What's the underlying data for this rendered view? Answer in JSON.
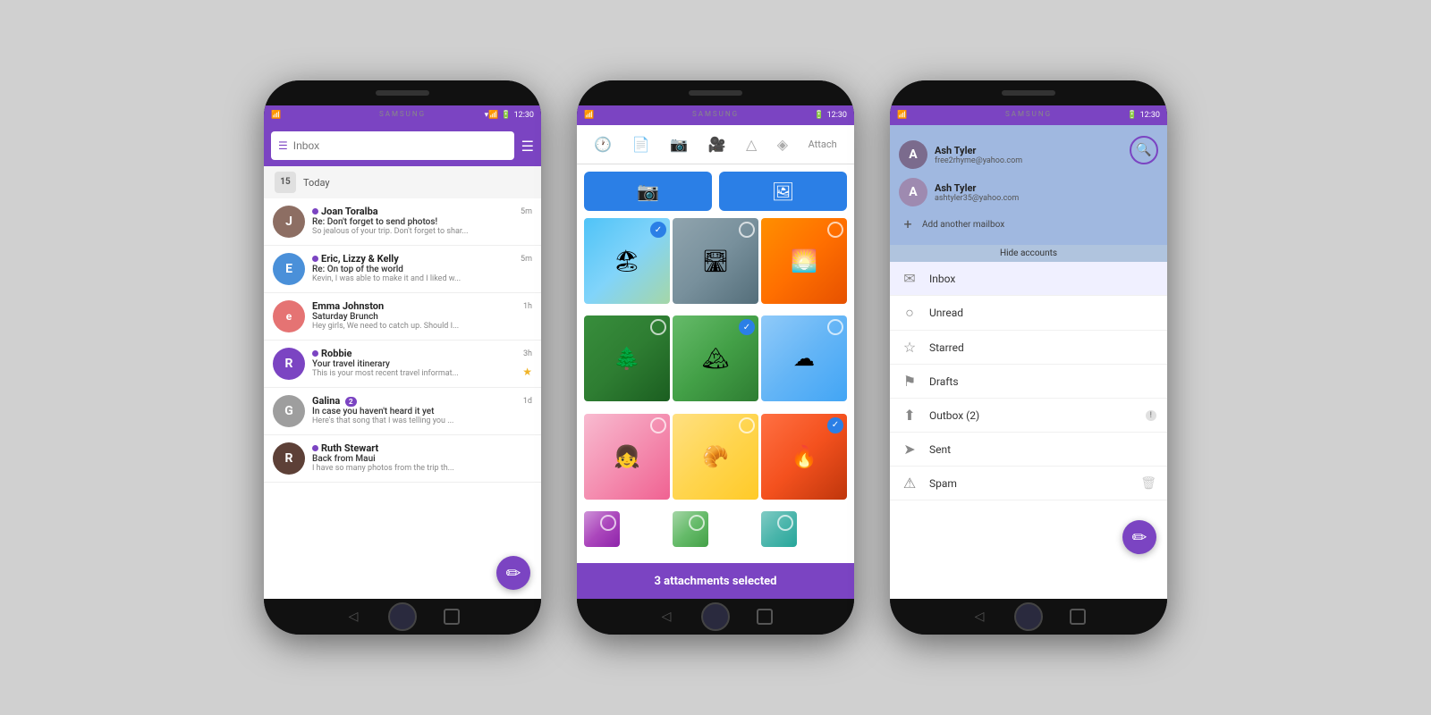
{
  "phones": {
    "phone1": {
      "statusBar": {
        "time": "12:30",
        "brand": "SAMSUNG"
      },
      "toolbar": {
        "searchPlaceholder": "Inbox",
        "listIconLabel": "≡"
      },
      "dateHeader": {
        "day": "15",
        "label": "Today"
      },
      "emails": [
        {
          "sender": "Joan Toralba",
          "subject": "Re: Don't forget to send photos!",
          "preview": "So jealous of your trip. Don't forget to shar...",
          "time": "5m",
          "unread": true,
          "avatarColor": "#8d6e63",
          "avatarInitial": "J"
        },
        {
          "sender": "Eric, Lizzy & Kelly",
          "subject": "Re: On top of the world",
          "preview": "Kevin, I was able to make it and I liked w...",
          "time": "5m",
          "unread": true,
          "avatarColor": "#4a90d9",
          "avatarInitial": "E"
        },
        {
          "sender": "Emma Johnston",
          "subject": "Saturday Brunch",
          "preview": "Hey girls, We need to catch up. Should I...",
          "time": "1h",
          "unread": false,
          "avatarColor": "#e57373",
          "avatarInitial": "e"
        },
        {
          "sender": "Robbie",
          "subject": "Your travel itinerary",
          "preview": "This is your most recent travel informat...",
          "time": "3h",
          "unread": true,
          "avatarColor": "#7b44c2",
          "avatarInitial": "R",
          "starred": true
        },
        {
          "sender": "Galina",
          "subject": "In case you haven't heard it yet",
          "preview": "Here's that song that I was telling you ...",
          "time": "1d",
          "unread": false,
          "avatarColor": "#9e9e9e",
          "avatarInitial": "G",
          "badge": 2
        },
        {
          "sender": "Ruth Stewart",
          "subject": "Back from Maui",
          "preview": "I have so many photos from the trip th...",
          "time": "",
          "unread": true,
          "avatarColor": "#5d4037",
          "avatarInitial": "R"
        }
      ]
    },
    "phone2": {
      "statusBar": {
        "time": "12:30",
        "brand": "SAMSUNG"
      },
      "attachLabel": "Attach",
      "attachmentsSelectedText": "3 attachments selected",
      "photos": [
        {
          "type": "beach",
          "selected": true
        },
        {
          "type": "road",
          "selected": false
        },
        {
          "type": "sunset",
          "selected": false
        },
        {
          "type": "forest",
          "selected": false
        },
        {
          "type": "green",
          "selected": true
        },
        {
          "type": "sky",
          "selected": false
        },
        {
          "type": "girl",
          "selected": false
        },
        {
          "type": "food",
          "selected": false
        },
        {
          "type": "fire",
          "selected": true
        },
        {
          "type": "partial1",
          "selected": false
        },
        {
          "type": "partial2",
          "selected": false
        },
        {
          "type": "partial3",
          "selected": false
        }
      ]
    },
    "phone3": {
      "statusBar": {
        "time": "12:30",
        "brand": "SAMSUNG"
      },
      "accounts": [
        {
          "name": "Ash Tyler",
          "email": "free2rhyme@yahoo.com"
        },
        {
          "name": "Ash Tyler",
          "email": "ashtyler35@yahoo.com"
        }
      ],
      "addAccountLabel": "Add another mailbox",
      "hideAccountsLabel": "Hide accounts",
      "navItems": [
        {
          "icon": "✉",
          "label": "Inbox",
          "active": true
        },
        {
          "icon": "○",
          "label": "Unread",
          "active": false
        },
        {
          "icon": "☆",
          "label": "Starred",
          "active": false
        },
        {
          "icon": "⚑",
          "label": "Drafts",
          "active": false
        },
        {
          "icon": "⬆",
          "label": "Outbox (2)",
          "active": false,
          "badge": "!"
        },
        {
          "icon": "➤",
          "label": "Sent",
          "active": false
        },
        {
          "icon": "⚠",
          "label": "Spam",
          "active": false,
          "trash": true
        }
      ]
    }
  }
}
